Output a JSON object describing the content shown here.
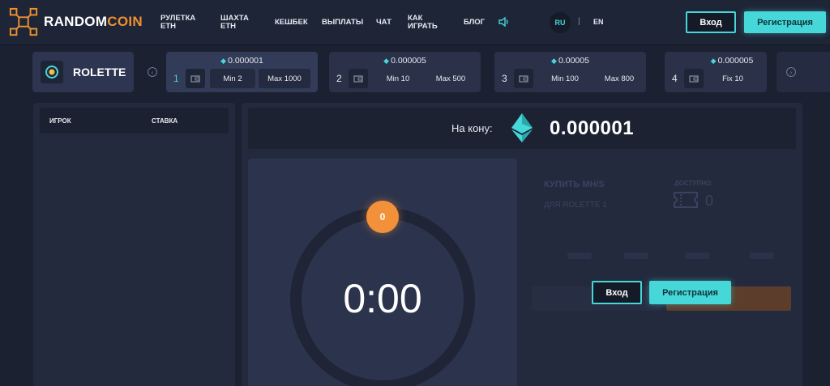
{
  "header": {
    "logo_word_white": "RANDOM",
    "logo_word_orange": "COIN",
    "nav": [
      {
        "id": "roulette",
        "line1": "РУЛЕТКА",
        "line2": "ETH"
      },
      {
        "id": "mine",
        "line1": "ШАХТА",
        "line2": "ETH"
      },
      {
        "id": "cashback",
        "line1": "КЕШБЕК",
        "line2": ""
      },
      {
        "id": "payouts",
        "line1": "ВЫПЛАТЫ",
        "line2": ""
      },
      {
        "id": "chat",
        "line1": "ЧАТ",
        "line2": ""
      },
      {
        "id": "howto",
        "line1": "КАК",
        "line2": "ИГРАТЬ"
      },
      {
        "id": "blog",
        "line1": "БЛОГ",
        "line2": ""
      }
    ],
    "lang_active": "RU",
    "lang_sep": "|",
    "lang_other": "EN",
    "login_label": "Вход",
    "register_label": "Регистрация"
  },
  "game": {
    "name": "ROLETTE"
  },
  "rooms": [
    {
      "num": "1",
      "price": "0.000001",
      "min": "Min 2",
      "max": "Max 1000"
    },
    {
      "num": "2",
      "price": "0.000005",
      "min": "Min 10",
      "max": "Max 500"
    },
    {
      "num": "3",
      "price": "0.00005",
      "min": "Min 100",
      "max": "Max 800"
    },
    {
      "num": "4",
      "price": "0.000005",
      "fix": "Fix 10"
    }
  ],
  "players": {
    "col_player": "ИГРОК",
    "col_bet": "СТАВКА"
  },
  "pot": {
    "label": "На кону:",
    "value": "0.000001"
  },
  "wheel": {
    "timer": "0:00",
    "count": "0"
  },
  "buy": {
    "title": "КУПИТЬ MH/S",
    "subtitle": "ДЛЯ ROLETTE 1",
    "available_label": "ДОСТУПНО:",
    "available_value": "0"
  },
  "overlay": {
    "login_label": "Вход",
    "register_label": "Регистрация"
  },
  "colors": {
    "accent": "#46d7d9",
    "brand_orange": "#f0912f",
    "background": "#1b2131"
  }
}
